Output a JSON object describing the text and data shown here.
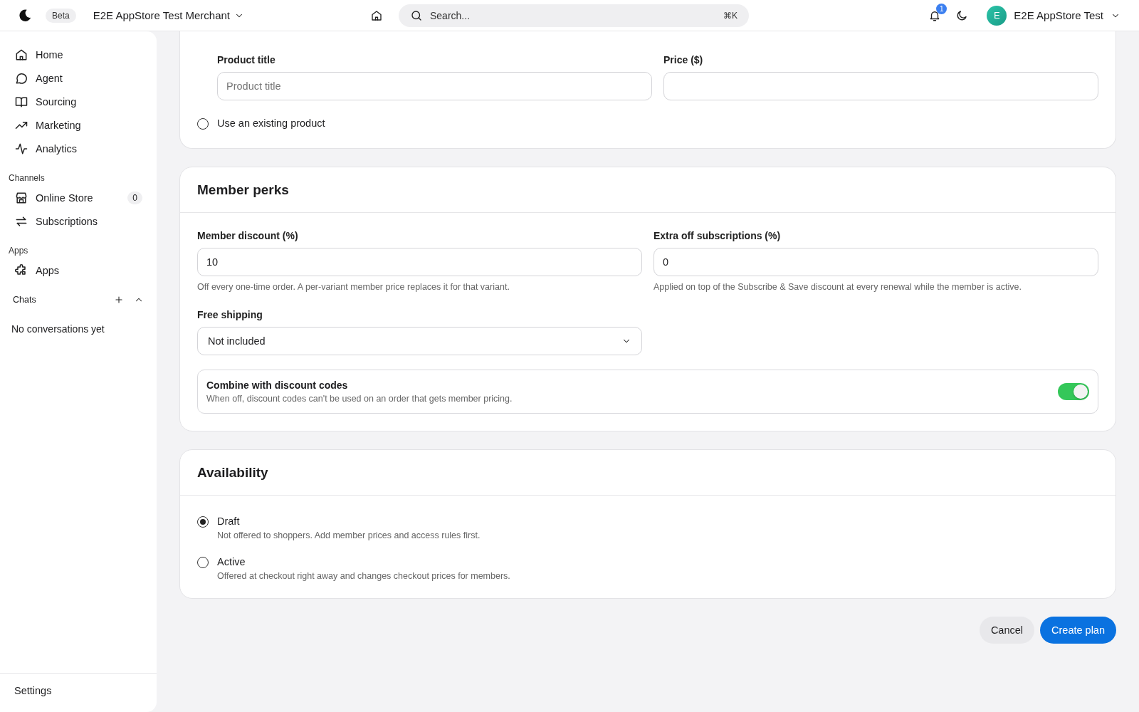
{
  "topbar": {
    "badge": "Beta",
    "merchant": "E2E AppStore Test Merchant",
    "search": {
      "placeholder": "Search..."
    },
    "shortcut": "⌘K",
    "notifications": "1",
    "avatar": "E",
    "user": "E2E AppStore Test"
  },
  "sidebar": {
    "groups": [
      {
        "items": [
          {
            "label": "Home",
            "kind": "home"
          },
          {
            "label": "Agent",
            "kind": "chat"
          },
          {
            "label": "Sourcing",
            "kind": "book"
          },
          {
            "label": "Marketing",
            "kind": "trend"
          },
          {
            "label": "Analytics",
            "kind": "pulse"
          }
        ]
      },
      {
        "title": "Channels",
        "items": [
          {
            "label": "Online Store",
            "kind": "store",
            "count": "0"
          },
          {
            "label": "Subscriptions",
            "kind": "repeat"
          }
        ]
      },
      {
        "title": "Apps",
        "items": [
          {
            "label": "Apps",
            "kind": "puzzle"
          }
        ]
      }
    ],
    "chats": {
      "title": "Chats",
      "empty": "No conversations yet"
    },
    "settings": "Settings"
  },
  "product": {
    "fields": [
      {
        "label": "Product title",
        "placeholder": "Product title"
      },
      {
        "label": "Price ($)"
      }
    ],
    "options": [
      {
        "label": "Use an existing product",
        "selected": false
      }
    ]
  },
  "member_perks": {
    "title": "Member perks",
    "fields": [
      {
        "label": "Member discount (%)",
        "value": "10",
        "help": "Off every one-time order. A per-variant member price replaces it for that variant."
      },
      {
        "label": "Extra off subscriptions (%)",
        "value": "0",
        "help": "Applied on top of the Subscribe & Save discount at every renewal while the member is active."
      }
    ],
    "free_shipping": {
      "label": "Free shipping",
      "value": "Not included"
    },
    "combine": {
      "title": "Combine with discount codes",
      "description": "When off, discount codes can't be used on an order that gets member pricing.",
      "on": true
    }
  },
  "availability": {
    "title": "Availability",
    "options": [
      {
        "label": "Draft",
        "description": "Not offered to shoppers. Add member prices and access rules first.",
        "selected": true
      },
      {
        "label": "Active",
        "description": "Offered at checkout right away and changes checkout prices for members.",
        "selected": false
      }
    ]
  },
  "actions": [
    {
      "label": "Cancel",
      "kind": "secondary"
    },
    {
      "label": "Create plan",
      "kind": "primary"
    }
  ]
}
